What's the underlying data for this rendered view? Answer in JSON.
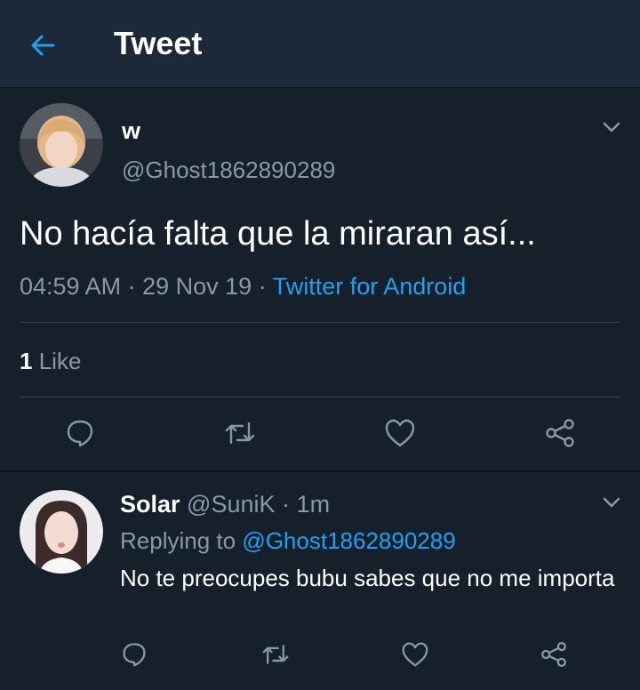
{
  "header": {
    "title": "Tweet",
    "back_icon": "arrow-left-icon",
    "accent": "#1da1f2"
  },
  "tweet": {
    "display_name": "w",
    "handle": "@Ghost1862890289",
    "text": "No hacía falta que la miraran así...",
    "time": "04:59 AM",
    "date": "29 Nov 19",
    "source": "Twitter for Android",
    "likes_count": "1",
    "likes_label": "Like",
    "actions": [
      "reply-icon",
      "retweet-icon",
      "like-icon",
      "share-icon"
    ]
  },
  "reply": {
    "display_name": "Solar",
    "handle": "@SuniK",
    "age": "1m",
    "replying_label": "Replying to",
    "replying_to": "@Ghost1862890289",
    "text": "No te preocupes bubu sabes que no me importa"
  },
  "colors": {
    "background": "#15202b",
    "header": "#1c2938",
    "secondary_text": "#8899a6",
    "link": "#1da1f2",
    "divider": "#38444d"
  }
}
